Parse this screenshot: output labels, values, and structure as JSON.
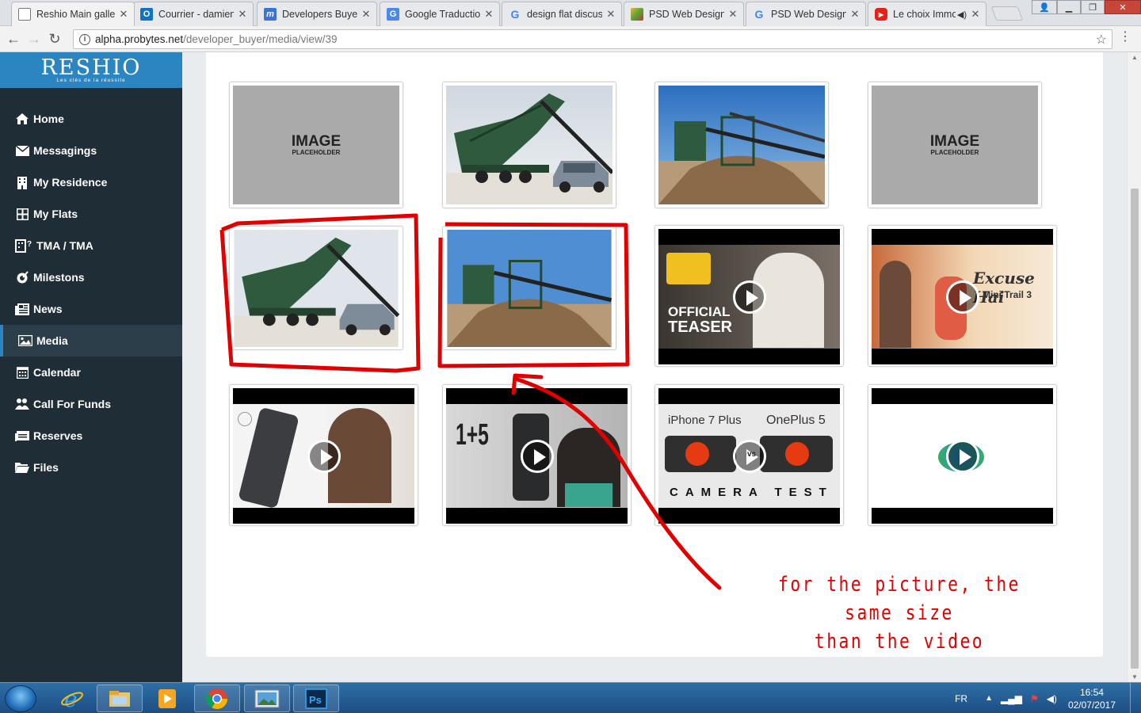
{
  "browser": {
    "tabs": [
      {
        "title": "Reshio Main galle",
        "icon": "page-icon",
        "color": "#ffffff",
        "active": true
      },
      {
        "title": "Courrier - damien",
        "icon": "outlook-icon",
        "color": "#1173c4"
      },
      {
        "title": "Developers Buyer",
        "icon": "m-icon",
        "color": "#3a73d6"
      },
      {
        "title": "Google Traductio",
        "icon": "translate-icon",
        "color": "#4a87ee"
      },
      {
        "title": "design flat discus",
        "icon": "google-icon",
        "color": "#ffffff"
      },
      {
        "title": "PSD Web Design",
        "icon": "psd-icon",
        "color": "#e8b530"
      },
      {
        "title": "PSD Web Design",
        "icon": "google-icon",
        "color": "#ffffff"
      },
      {
        "title": "Le choix Immo",
        "icon": "youtube-icon",
        "color": "#e62117"
      }
    ],
    "url_host": "alpha.probytes.net",
    "url_path": "/developer_buyer/media/view/39"
  },
  "sidebar": {
    "logo": "RESHIO",
    "tagline": "Les clés de la réussite",
    "items": [
      {
        "label": "Home",
        "icon": "home-icon"
      },
      {
        "label": "Messagings",
        "icon": "envelope-icon"
      },
      {
        "label": "My Residence",
        "icon": "building-icon"
      },
      {
        "label": "My Flats",
        "icon": "grid-icon"
      },
      {
        "label": "TMA / TMA",
        "icon": "tma-icon"
      },
      {
        "label": "Milestons",
        "icon": "milestone-icon"
      },
      {
        "label": "News",
        "icon": "newspaper-icon"
      },
      {
        "label": "Media",
        "icon": "image-icon",
        "active": true
      },
      {
        "label": "Calendar",
        "icon": "calendar-icon"
      },
      {
        "label": "Call For Funds",
        "icon": "funds-icon"
      },
      {
        "label": "Reserves",
        "icon": "reserves-icon"
      },
      {
        "label": "Files",
        "icon": "folder-icon"
      }
    ]
  },
  "gallery": {
    "placeholder_title": "IMAGE",
    "placeholder_sub": "PLACEHOLDER",
    "videos": {
      "teaser_title": "OFFICIAL",
      "teaser_sub": "TEASER",
      "excuse_title": "Excuse Hai",
      "excuse_sub": "Mini Trail 3",
      "compare_left": "1+5",
      "camera_a": "iPhone 7 Plus",
      "camera_b": "OnePlus 5",
      "camera_caption": "CAMERA TEST",
      "vs_label": "vs"
    }
  },
  "annotation": {
    "line1": "for the picture, the same size",
    "line2": "than the video"
  },
  "taskbar": {
    "lang": "FR",
    "time": "16:54",
    "date": "02/07/2017"
  }
}
